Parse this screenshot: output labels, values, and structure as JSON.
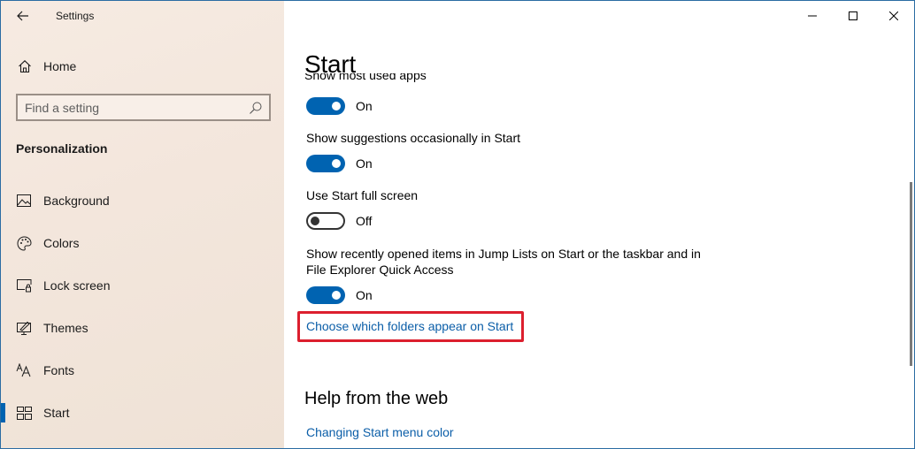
{
  "window": {
    "app_title": "Settings",
    "controls": {
      "minimize": "minimize-icon",
      "maximize": "maximize-icon",
      "close": "close-icon"
    }
  },
  "sidebar": {
    "back_icon": "back-arrow-icon",
    "home": {
      "label": "Home",
      "icon": "home-icon"
    },
    "search": {
      "placeholder": "Find a setting",
      "value": "",
      "icon": "search-icon"
    },
    "section_title": "Personalization",
    "items": [
      {
        "label": "Background",
        "icon": "background-image-icon",
        "active": false
      },
      {
        "label": "Colors",
        "icon": "palette-icon",
        "active": false
      },
      {
        "label": "Lock screen",
        "icon": "lock-screen-icon",
        "active": false
      },
      {
        "label": "Themes",
        "icon": "themes-icon",
        "active": false
      },
      {
        "label": "Fonts",
        "icon": "fonts-icon",
        "active": false
      },
      {
        "label": "Start",
        "icon": "start-tiles-icon",
        "active": true
      }
    ],
    "accent_color": "#0063b1"
  },
  "main": {
    "title": "Start",
    "cutoff_label": "Show most used apps",
    "settings": [
      {
        "label": "",
        "state": "On",
        "on": true
      },
      {
        "label": "Show suggestions occasionally in Start",
        "state": "On",
        "on": true
      },
      {
        "label": "Use Start full screen",
        "state": "Off",
        "on": false
      },
      {
        "label": "Show recently opened items in Jump Lists on Start or the taskbar and in File Explorer Quick Access",
        "state": "On",
        "on": true
      }
    ],
    "folders_link": "Choose which folders appear on Start",
    "help_heading": "Help from the web",
    "help_link": "Changing Start menu color",
    "highlight_color": "#dc1f2e",
    "link_color": "#0b5ea8"
  }
}
